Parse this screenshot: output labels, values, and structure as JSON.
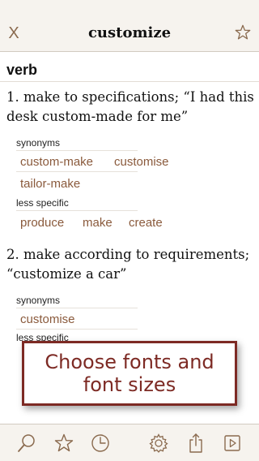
{
  "header": {
    "close_label": "X",
    "title": "customize",
    "favorite_icon": "star-icon"
  },
  "part_of_speech": "verb",
  "senses": [
    {
      "definition": "1. make to specifications; “I had this desk custom-made for me”",
      "synonyms_label": "synonyms",
      "synonyms": [
        "custom-make",
        "customise",
        "tailor-make"
      ],
      "less_specific_label": "less specific",
      "less_specific": [
        "produce",
        "make",
        "create"
      ]
    },
    {
      "definition": "2. make according to requirements; “customize a car”",
      "synonyms_label": "synonyms",
      "synonyms": [
        "customise"
      ],
      "less_specific_label": "less specific"
    }
  ],
  "callout": {
    "line1": "Choose fonts and",
    "line2": "font sizes"
  },
  "toolbar": {
    "icons": [
      "search-icon",
      "star-icon",
      "history-icon",
      "settings-icon",
      "share-icon",
      "play-icon"
    ]
  },
  "colors": {
    "accent": "#8a6a4e",
    "link": "#8a5a3c",
    "callout": "#7d2a24",
    "bar_background": "#f6f3ee"
  }
}
